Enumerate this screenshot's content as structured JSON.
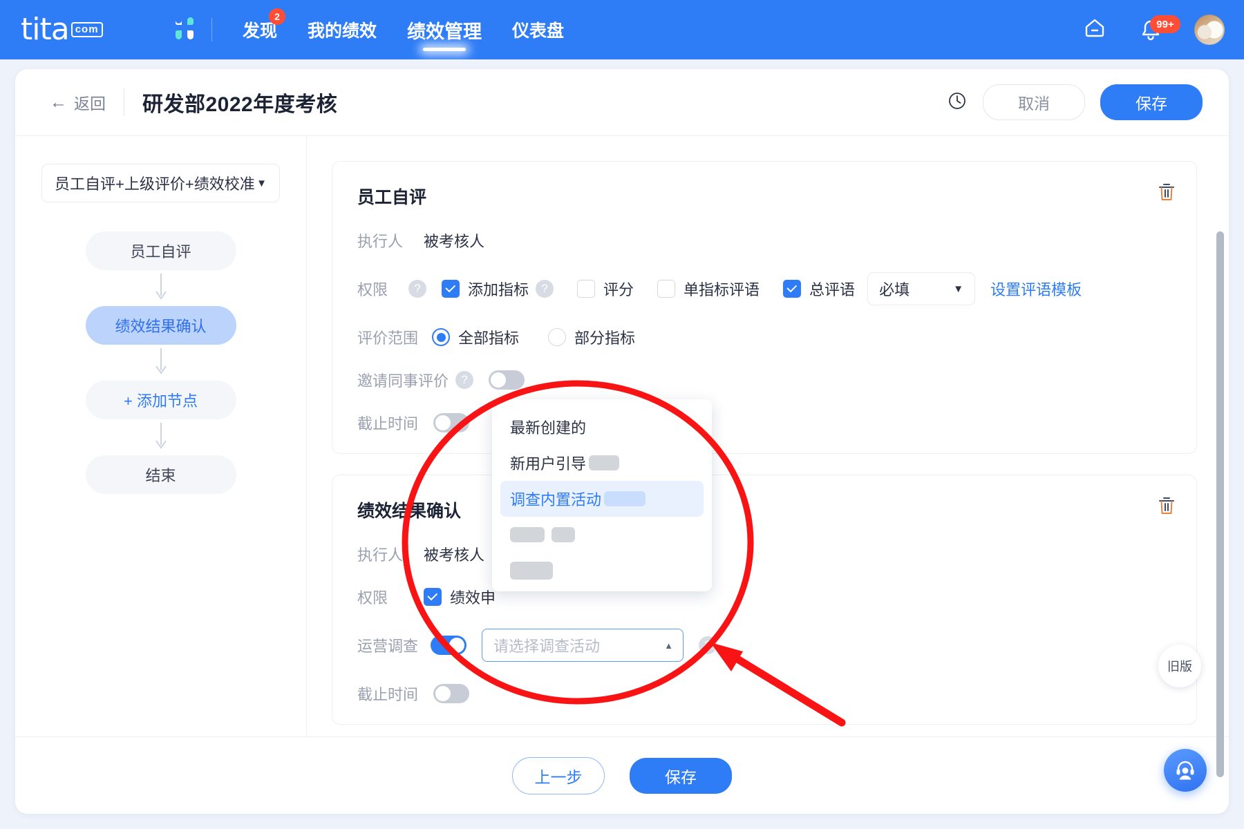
{
  "topbar": {
    "logo": {
      "name": "tita",
      "suffix": "com"
    },
    "apps_icon": "grid-apps-icon",
    "nav": [
      {
        "label": "发现",
        "badge": "2",
        "active": false
      },
      {
        "label": "我的绩效",
        "badge": "",
        "active": false
      },
      {
        "label": "绩效管理",
        "badge": "",
        "active": true
      },
      {
        "label": "仪表盘",
        "badge": "",
        "active": false
      }
    ],
    "home_icon": "home-icon",
    "bell_icon": "bell-icon",
    "bell_badge": "99+",
    "avatar": "user-avatar"
  },
  "pagehead": {
    "back_label": "返回",
    "back_icon": "arrow-left-icon",
    "title": "研发部2022年度考核",
    "history_icon": "clock-history-icon",
    "cancel_label": "取消",
    "save_label": "保存"
  },
  "sidebar": {
    "mode_select": {
      "value": "员工自评+上级评价+绩效校准",
      "caret": "chevron-down-icon"
    },
    "nodes": [
      {
        "label": "员工自评",
        "state": "normal"
      },
      {
        "label": "绩效结果确认",
        "state": "selected"
      },
      {
        "label": "+ 添加节点",
        "state": "add"
      },
      {
        "label": "结束",
        "state": "normal"
      }
    ]
  },
  "cards": [
    {
      "title": "员工自评",
      "delete_icon": "trash-icon",
      "executor_label": "执行人",
      "executor_value": "被考核人",
      "permission_label": "权限",
      "permission_help": "?",
      "checkboxes": [
        {
          "label": "添加指标",
          "checked": true,
          "help": "?"
        },
        {
          "label": "评分",
          "checked": false,
          "help": ""
        },
        {
          "label": "单指标评语",
          "checked": false,
          "help": ""
        },
        {
          "label": "总评语",
          "checked": true,
          "help": ""
        }
      ],
      "comment_required": {
        "value": "必填",
        "caret": "chevron-down-icon"
      },
      "template_link": "设置评语模板",
      "scope_label": "评价范围",
      "scope_options": [
        {
          "label": "全部指标",
          "selected": true
        },
        {
          "label": "部分指标",
          "selected": false
        }
      ],
      "invite_label": "邀请同事评价",
      "invite_help": "?",
      "invite_on": false,
      "deadline_label": "截止时间",
      "deadline_on": false
    },
    {
      "title": "绩效结果确认",
      "delete_icon": "trash-icon",
      "executor_label": "执行人",
      "executor_value": "被考核人",
      "permission_label": "权限",
      "permission_checkbox": {
        "label": "绩效申",
        "checked": true
      },
      "survey_label": "运营调查",
      "survey_on": true,
      "survey_placeholder": "请选择调查活动",
      "survey_caret": "chevron-up-icon",
      "survey_help": "?",
      "deadline_label": "截止时间",
      "deadline_on": false
    }
  ],
  "dropdown": {
    "items": [
      {
        "label": "最新创建的",
        "selected": false,
        "redact": 0
      },
      {
        "label": "新用户引导",
        "selected": false,
        "redact": 74
      },
      {
        "label": "调查内置活动",
        "selected": true,
        "redact": 96
      },
      {
        "label": "",
        "selected": false,
        "redact": 0
      },
      {
        "label": "",
        "selected": false,
        "redact": 0
      }
    ]
  },
  "bottombar": {
    "prev_label": "上一步",
    "save_label": "保存"
  },
  "floating": {
    "old_version_label": "旧版",
    "support_icon": "headset-support-icon"
  },
  "colors": {
    "brand_blue": "#2e7cf6",
    "badge_red": "#ff4d36",
    "annotation_red": "#f81414",
    "page_bg": "#eef2fa"
  }
}
